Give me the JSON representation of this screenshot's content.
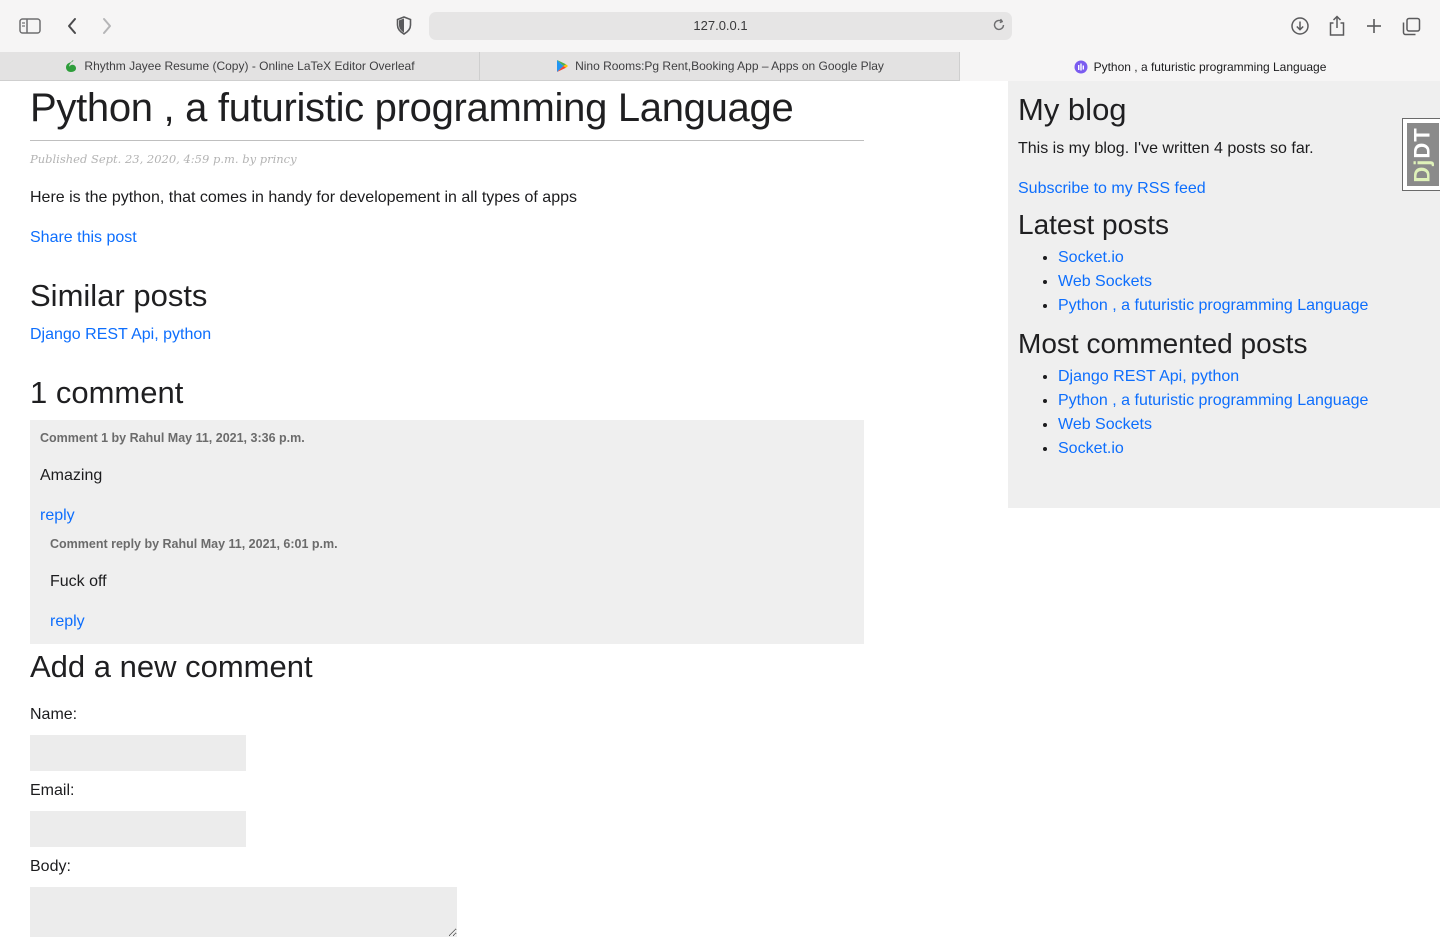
{
  "browser": {
    "url": "127.0.0.1",
    "tabs": [
      {
        "label": "Rhythm Jayee Resume (Copy) - Online LaTeX Editor Overleaf",
        "icon": "overleaf-icon",
        "active": false
      },
      {
        "label": "Nino Rooms:Pg Rent,Booking App – Apps on Google Play",
        "icon": "google-play-icon",
        "active": false
      },
      {
        "label": "Python , a futuristic programming Language",
        "icon": "site-favicon",
        "active": true
      }
    ]
  },
  "post": {
    "title": "Python , a futuristic programming Language",
    "published": "Published Sept. 23, 2020, 4:59 p.m. by princy",
    "body": "Here is the python, that comes in handy for developement in all types of apps",
    "share_label": "Share this post"
  },
  "similar": {
    "heading": "Similar posts",
    "links": [
      "Django REST Api, python"
    ]
  },
  "comments": {
    "heading": "1 comment",
    "items": [
      {
        "meta": "Comment 1 by Rahul May 11, 2021, 3:36 p.m.",
        "text": "Amazing",
        "reply_label": "reply",
        "replies": [
          {
            "meta": "Comment reply by Rahul May 11, 2021, 6:01 p.m.",
            "text": "Fuck off",
            "reply_label": "reply"
          }
        ]
      }
    ]
  },
  "form": {
    "heading": "Add a new comment",
    "name_label": "Name:",
    "email_label": "Email:",
    "body_label": "Body:"
  },
  "sidebar": {
    "title": "My blog",
    "description": "This is my blog. I've written 4 posts so far.",
    "rss_label": "Subscribe to my RSS feed",
    "latest_heading": "Latest posts",
    "latest": [
      "Socket.io",
      "Web Sockets",
      "Python , a futuristic programming Language"
    ],
    "most_commented_heading": "Most commented posts",
    "most_commented": [
      "Django REST Api, python",
      "Python , a futuristic programming Language",
      "Web Sockets",
      "Socket.io"
    ]
  },
  "debug_toolbar": {
    "label_dj": "Dj",
    "label_dt": "DT"
  },
  "colors": {
    "link": "#0d6efd",
    "comment_bg": "#efefef",
    "sidebar_bg": "#efefef"
  }
}
